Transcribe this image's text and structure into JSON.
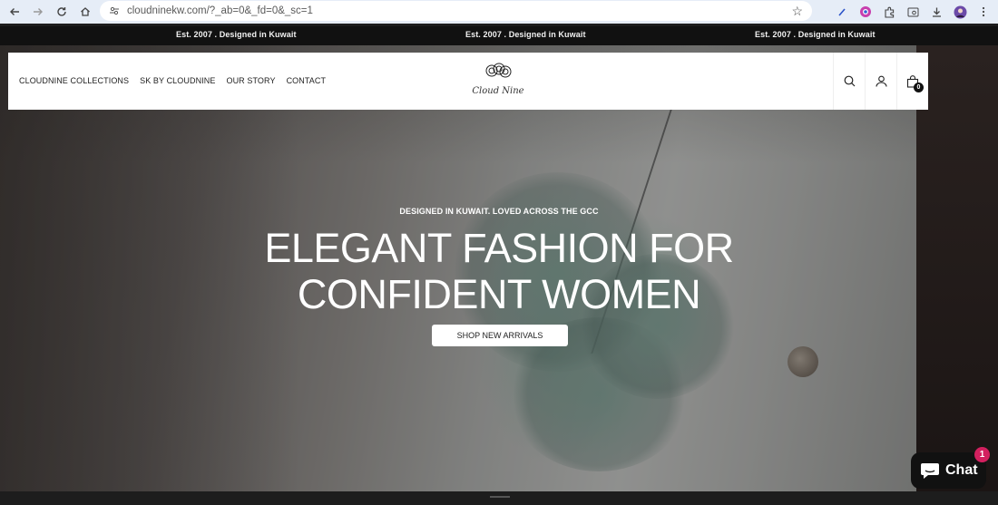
{
  "browser": {
    "url": "cloudninekw.com/?_ab=0&_fd=0&_sc=1"
  },
  "announcement": {
    "items": [
      "Est. 2007 . Designed in Kuwait",
      "Est. 2007 . Designed in Kuwait",
      "Est. 2007 . Designed in Kuwait"
    ]
  },
  "header": {
    "nav": [
      "CLOUDNINE COLLECTIONS",
      "SK BY CLOUDNINE",
      "OUR STORY",
      "CONTACT"
    ],
    "logo_text": "Cloud Nine",
    "cart_count": "0"
  },
  "hero": {
    "eyebrow": "DESIGNED IN KUWAIT. LOVED ACROSS THE GCC",
    "headline_line1": "ELEGANT FASHION FOR",
    "headline_line2": "CONFIDENT WOMEN",
    "cta": "SHOP NEW ARRIVALS"
  },
  "chat": {
    "label": "Chat",
    "badge": "1"
  },
  "colors": {
    "announcement_bg": "#111111",
    "chat_bg": "#111111",
    "badge": "#d3205f"
  }
}
